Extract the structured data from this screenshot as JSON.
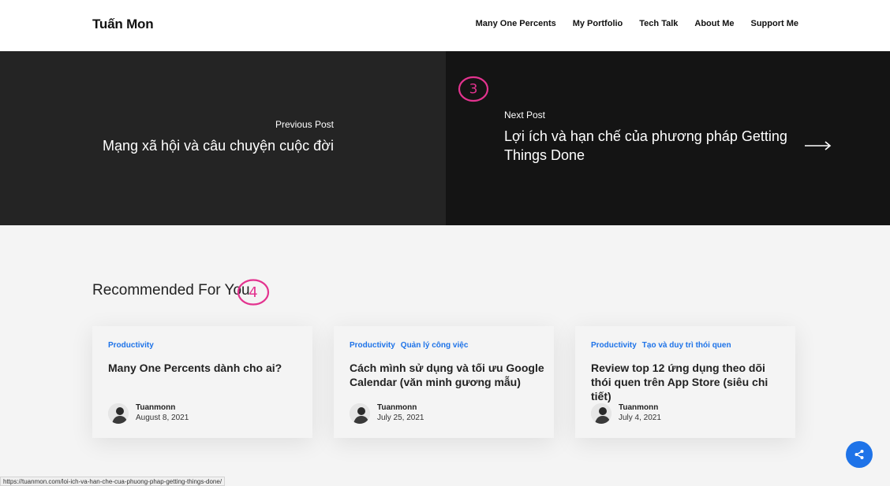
{
  "header": {
    "logo": "Tuấn Mon",
    "nav": [
      "Many One Percents",
      "My Portfolio",
      "Tech Talk",
      "About Me",
      "Support Me"
    ]
  },
  "post_nav": {
    "previous": {
      "label": "Previous Post",
      "title": "Mạng xã hội và câu chuyện cuộc đời"
    },
    "next": {
      "label": "Next Post",
      "title": "Lợi ích và hạn chế của phương pháp Getting Things Done"
    }
  },
  "annotations": {
    "a3": "3",
    "a4": "4",
    "color": "#e3338f"
  },
  "recommended": {
    "title": "Recommended For You",
    "cards": [
      {
        "categories": [
          "Productivity"
        ],
        "title": "Many One Percents dành cho ai?",
        "author": "Tuanmonn",
        "date": "August 8, 2021"
      },
      {
        "categories": [
          "Productivity",
          "Quản lý công việc"
        ],
        "title": "Cách mình sử dụng và tối ưu Google Calendar (văn minh gương mẫu)",
        "author": "Tuanmonn",
        "date": "July 25, 2021"
      },
      {
        "categories": [
          "Productivity",
          "Tạo và duy trì thói quen"
        ],
        "title": "Review top 12 ứng dụng theo dõi thói quen trên App Store (siêu chi tiết)",
        "author": "Tuanmonn",
        "date": "July 4, 2021"
      }
    ]
  },
  "share": {
    "icon": "share-icon"
  },
  "status_bar": {
    "url": "https://tuanmon.com/loi-ich-va-han-che-cua-phuong-phap-getting-things-done/"
  },
  "colors": {
    "accent": "#1e73e8",
    "prev_bg": "#242424",
    "next_bg": "#141414"
  }
}
